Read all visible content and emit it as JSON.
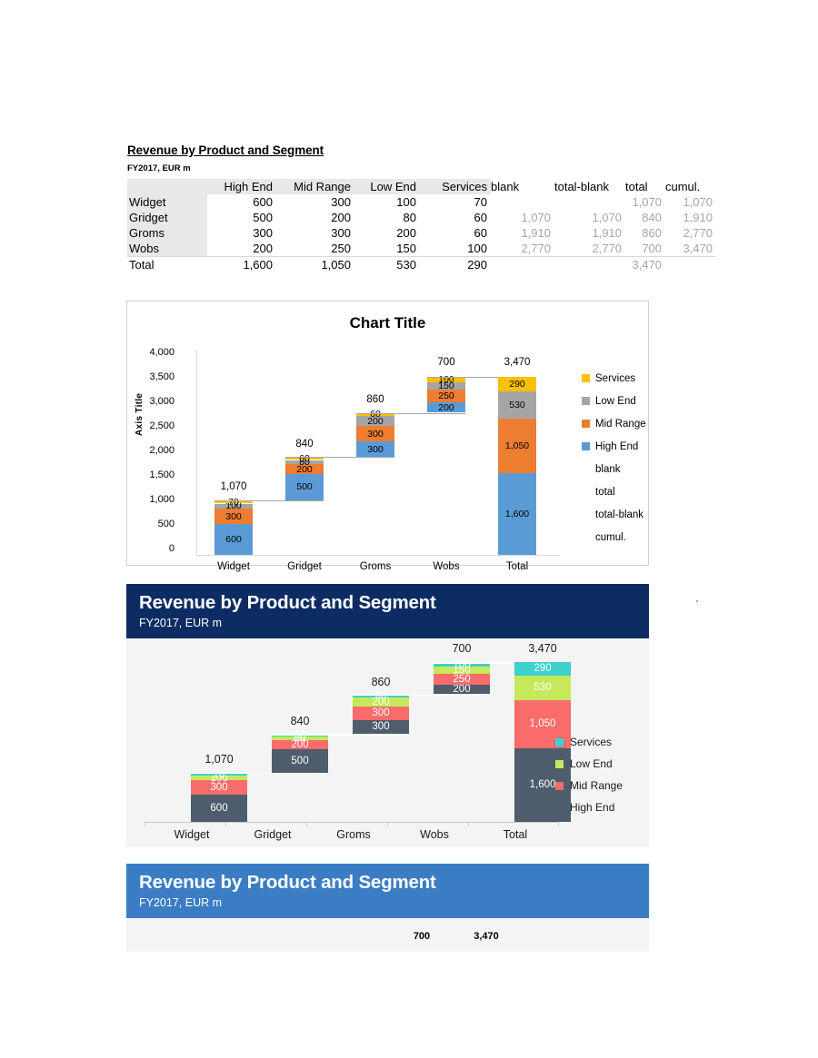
{
  "document": {
    "title": "Revenue by Product and Segment",
    "subtitle": "FY2017, EUR m"
  },
  "table": {
    "headers": [
      "",
      "High End",
      "Mid Range",
      "Low End",
      "Services",
      "blank",
      "total-blank",
      "total",
      "cumul."
    ],
    "rows": [
      {
        "label": "Widget",
        "high_end": "600",
        "mid_range": "300",
        "low_end": "100",
        "services": "70",
        "blank": "",
        "total_blank": "",
        "total": "1,070",
        "cumul": "1,070"
      },
      {
        "label": "Gridget",
        "high_end": "500",
        "mid_range": "200",
        "low_end": "80",
        "services": "60",
        "blank": "1,070",
        "total_blank": "1,070",
        "total": "840",
        "cumul": "1,910"
      },
      {
        "label": "Groms",
        "high_end": "300",
        "mid_range": "300",
        "low_end": "200",
        "services": "60",
        "blank": "1,910",
        "total_blank": "1,910",
        "total": "860",
        "cumul": "2,770"
      },
      {
        "label": "Wobs",
        "high_end": "200",
        "mid_range": "250",
        "low_end": "150",
        "services": "100",
        "blank": "2,770",
        "total_blank": "2,770",
        "total": "700",
        "cumul": "3,470"
      },
      {
        "label": "Total",
        "high_end": "1,600",
        "mid_range": "1,050",
        "low_end": "530",
        "services": "290",
        "blank": "",
        "total_blank": "",
        "total": "3,470",
        "cumul": ""
      }
    ]
  },
  "chart1": {
    "title": "Chart Title",
    "y_axis_title": "Axis Title",
    "y_ticks": [
      "4,000",
      "3,500",
      "3,000",
      "2,500",
      "2,000",
      "1,500",
      "1,000",
      "500",
      "0"
    ],
    "categories": [
      "Widget",
      "Gridget",
      "Groms",
      "Wobs",
      "Total"
    ],
    "totals": [
      "1,070",
      "840",
      "860",
      "700",
      "3,470"
    ],
    "legend": [
      "Services",
      "Low End",
      "Mid Range",
      "High End",
      "blank",
      "total",
      "total-blank",
      "cumul."
    ],
    "colors": {
      "services": "#FFC000",
      "low_end": "#A5A5A5",
      "mid_range": "#ED7D31",
      "high_end": "#5B9BD5"
    },
    "segment_labels": {
      "Widget": {
        "high_end": "600",
        "mid_range": "300",
        "low_end": "100",
        "services": "70"
      },
      "Gridget": {
        "high_end": "500",
        "mid_range": "200",
        "low_end": "80",
        "services": "60"
      },
      "Groms": {
        "high_end": "300",
        "mid_range": "300",
        "low_end": "200",
        "services": "60"
      },
      "Wobs": {
        "high_end": "200",
        "mid_range": "250",
        "low_end": "150",
        "services": "100"
      },
      "Total": {
        "high_end": "1,600",
        "mid_range": "1,050",
        "low_end": "530",
        "services": "290"
      }
    }
  },
  "chart2": {
    "title": "Revenue by Product and Segment",
    "subtitle": "FY2017, EUR m",
    "header_color": "#0c2c63",
    "categories": [
      "Widget",
      "Gridget",
      "Groms",
      "Wobs",
      "Total"
    ],
    "totals": [
      "1,070",
      "840",
      "860",
      "700",
      "3,470"
    ],
    "legend": [
      "Services",
      "Low End",
      "Mid Range",
      "High End"
    ],
    "colors": {
      "services": "#3ECFCF",
      "low_end": "#C5E95A",
      "mid_range": "#FA6B6B",
      "high_end": "#4D5D6B"
    },
    "segment_labels": {
      "Widget": {
        "high_end": "600",
        "mid_range": "300",
        "low_end": "100",
        "services": "70"
      },
      "Gridget": {
        "high_end": "500",
        "mid_range": "200",
        "low_end": "80",
        "services": "60"
      },
      "Groms": {
        "high_end": "300",
        "mid_range": "300",
        "low_end": "200",
        "services": "60"
      },
      "Wobs": {
        "high_end": "200",
        "mid_range": "250",
        "low_end": "150",
        "services": "100"
      },
      "Total": {
        "high_end": "1,600",
        "mid_range": "1,050",
        "low_end": "530",
        "services": "290"
      }
    }
  },
  "chart3": {
    "title": "Revenue by Product and Segment",
    "subtitle": "FY2017, EUR m",
    "header_color": "#3b7dc4",
    "visible_totals": [
      "700",
      "3,470"
    ]
  },
  "chart_data": {
    "type": "bar",
    "subtype": "stacked-waterfall",
    "title": "Revenue by Product and Segment",
    "subtitle": "FY2017, EUR m",
    "xlabel": "",
    "ylabel": "Axis Title",
    "ylim": [
      0,
      4000
    ],
    "ytick_step": 500,
    "grid": false,
    "legend_position": "right",
    "categories": [
      "Widget",
      "Gridget",
      "Groms",
      "Wobs",
      "Total"
    ],
    "series": [
      {
        "name": "High End",
        "values": [
          600,
          500,
          300,
          200,
          1600
        ]
      },
      {
        "name": "Mid Range",
        "values": [
          300,
          200,
          300,
          250,
          1050
        ]
      },
      {
        "name": "Low End",
        "values": [
          100,
          80,
          200,
          150,
          530
        ]
      },
      {
        "name": "Services",
        "values": [
          70,
          60,
          60,
          100,
          290
        ]
      },
      {
        "name": "blank",
        "values": [
          0,
          1070,
          1910,
          2770,
          0
        ]
      }
    ],
    "category_totals": [
      1070,
      840,
      860,
      700,
      3470
    ],
    "cumulative": [
      1070,
      1910,
      2770,
      3470,
      null
    ],
    "annotations": [
      "1,070",
      "840",
      "860",
      "700",
      "3,470"
    ]
  }
}
